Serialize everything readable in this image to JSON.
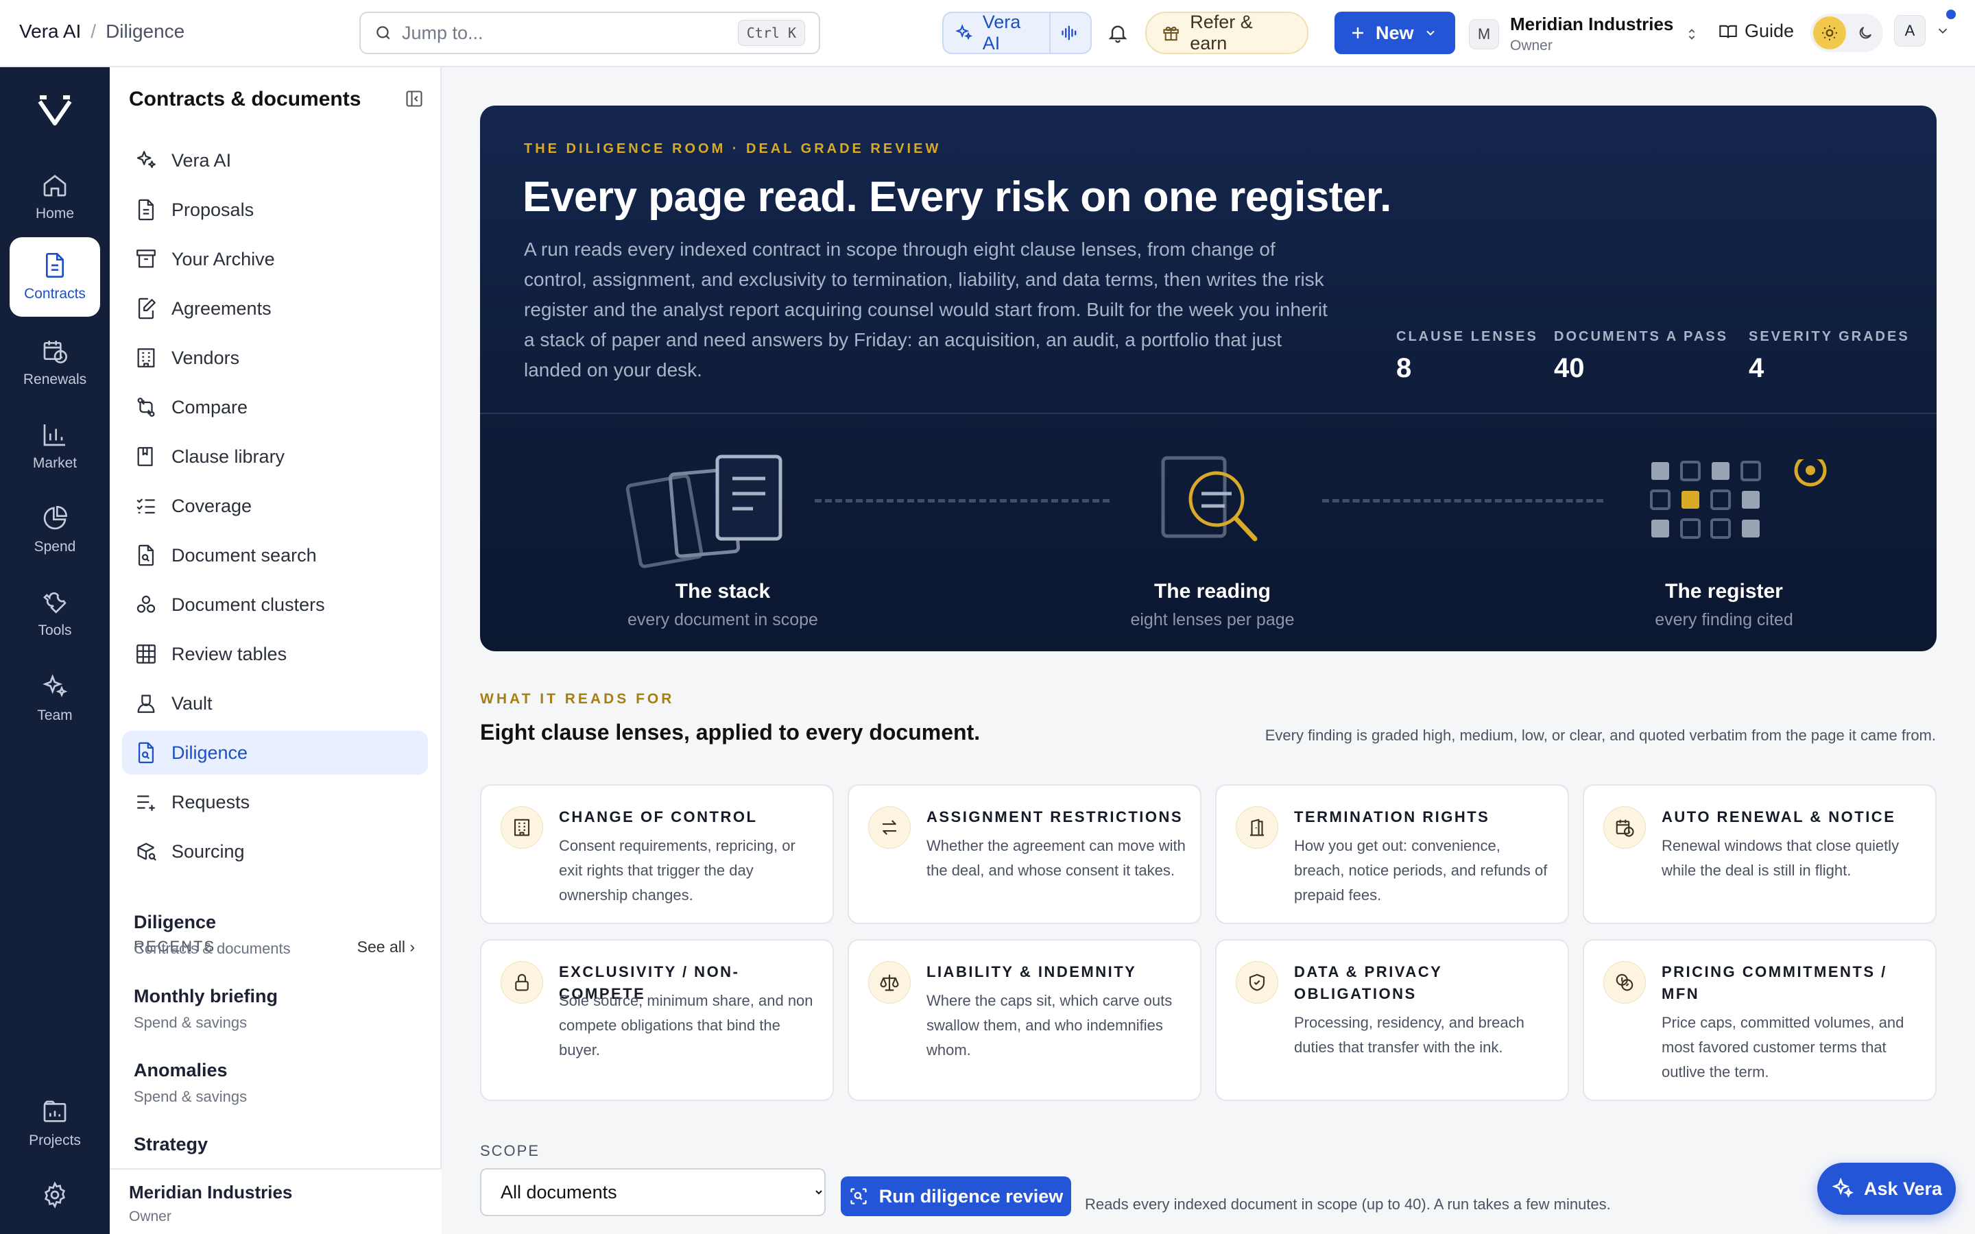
{
  "topbar": {
    "app_name": "Vera AI",
    "separator": "/",
    "current_page": "Diligence",
    "search_placeholder": "Jump to...",
    "search_shortcut": "Ctrl K",
    "vera_label": "Vera AI",
    "refer_label": "Refer & earn",
    "new_label": "New",
    "org_initial": "M",
    "org_name": "Meridian Industries",
    "org_role": "Owner",
    "guide_label": "Guide",
    "user_initial": "A"
  },
  "rail": {
    "items": [
      {
        "label": "Home",
        "icon": "home-icon"
      },
      {
        "label": "Contracts",
        "icon": "document-icon"
      },
      {
        "label": "Renewals",
        "icon": "calendar-clock-icon"
      },
      {
        "label": "Market",
        "icon": "bar-chart-icon"
      },
      {
        "label": "Spend",
        "icon": "pie-chart-icon"
      },
      {
        "label": "Tools",
        "icon": "wrench-icon"
      },
      {
        "label": "Team",
        "icon": "sparkles-icon"
      },
      {
        "label": "Projects",
        "icon": "folder-chart-icon"
      }
    ]
  },
  "nav": {
    "title": "Contracts & documents",
    "items": [
      {
        "label": "Vera AI",
        "icon": "sparkles-icon"
      },
      {
        "label": "Proposals",
        "icon": "file-text-icon"
      },
      {
        "label": "Your Archive",
        "icon": "archive-icon"
      },
      {
        "label": "Agreements",
        "icon": "file-edit-icon"
      },
      {
        "label": "Vendors",
        "icon": "building-icon"
      },
      {
        "label": "Compare",
        "icon": "compare-icon"
      },
      {
        "label": "Clause library",
        "icon": "book-icon"
      },
      {
        "label": "Coverage",
        "icon": "checklist-icon"
      },
      {
        "label": "Document search",
        "icon": "file-search-icon"
      },
      {
        "label": "Document clusters",
        "icon": "clusters-icon"
      },
      {
        "label": "Review tables",
        "icon": "grid-icon"
      },
      {
        "label": "Vault",
        "icon": "vault-icon"
      },
      {
        "label": "Diligence",
        "icon": "file-search-icon",
        "active": true
      },
      {
        "label": "Requests",
        "icon": "list-plus-icon"
      },
      {
        "label": "Sourcing",
        "icon": "package-search-icon"
      }
    ],
    "recents_label": "RECENTS",
    "see_all": "See all ›",
    "recents": [
      {
        "title": "Diligence",
        "sub": "Contracts & documents"
      },
      {
        "title": "Monthly briefing",
        "sub": "Spend & savings"
      },
      {
        "title": "Anomalies",
        "sub": "Spend & savings"
      },
      {
        "title": "Strategy",
        "sub": ""
      }
    ],
    "footer_name": "Meridian Industries",
    "footer_role": "Owner"
  },
  "hero": {
    "eyebrow": "THE DILIGENCE ROOM · DEAL GRADE REVIEW",
    "title": "Every page read. Every risk on one register.",
    "description": "A run reads every indexed contract in scope through eight clause lenses, from change of control, assignment, and exclusivity to termination, liability, and data terms, then writes the risk register and the analyst report acquiring counsel would start from. Built for the week you inherit a stack of paper and need answers by Friday: an acquisition, an audit, a portfolio that just landed on your desk.",
    "stats": [
      {
        "label": "CLAUSE LENSES",
        "value": "8"
      },
      {
        "label": "DOCUMENTS A PASS",
        "value": "40"
      },
      {
        "label": "SEVERITY GRADES",
        "value": "4"
      }
    ],
    "stages": [
      {
        "title": "The stack",
        "sub": "every document in scope"
      },
      {
        "title": "The reading",
        "sub": "eight lenses per page"
      },
      {
        "title": "The register",
        "sub": "every finding cited"
      }
    ],
    "accent": "#d9a928"
  },
  "lenses": {
    "eyebrow": "WHAT IT READS FOR",
    "title": "Eight clause lenses, applied to every document.",
    "note": "Every finding is graded high, medium, low, or clear, and quoted verbatim from the page it came from.",
    "cards": [
      {
        "title": "CHANGE OF CONTROL",
        "desc": "Consent requirements, repricing, or exit rights that trigger the day ownership changes.",
        "icon": "building-icon"
      },
      {
        "title": "ASSIGNMENT RESTRICTIONS",
        "desc": "Whether the agreement can move with the deal, and whose consent it takes.",
        "icon": "swap-arrows-icon"
      },
      {
        "title": "TERMINATION RIGHTS",
        "desc": "How you get out: convenience, breach, notice periods, and refunds of prepaid fees.",
        "icon": "door-icon"
      },
      {
        "title": "AUTO RENEWAL & NOTICE",
        "desc": "Renewal windows that close quietly while the deal is still in flight.",
        "icon": "calendar-clock-icon"
      },
      {
        "title": "EXCLUSIVITY / NON-COMPETE",
        "desc": "Sole source, minimum share, and non compete obligations that bind the buyer.",
        "icon": "lock-icon"
      },
      {
        "title": "LIABILITY & INDEMNITY",
        "desc": "Where the caps sit, which carve outs swallow them, and who indemnifies whom.",
        "icon": "scale-icon"
      },
      {
        "title": "DATA & PRIVACY OBLIGATIONS",
        "desc": "Processing, residency, and breach duties that transfer with the ink.",
        "icon": "shield-icon"
      },
      {
        "title": "PRICING COMMITMENTS / MFN",
        "desc": "Price caps, committed volumes, and most favored customer terms that outlive the term.",
        "icon": "coins-icon"
      }
    ]
  },
  "scope": {
    "label": "SCOPE",
    "selected": "All documents",
    "run_label": "Run diligence review",
    "note": "Reads every indexed document in scope (up to 40). A run takes a few minutes."
  },
  "ask_vera_label": "Ask Vera"
}
